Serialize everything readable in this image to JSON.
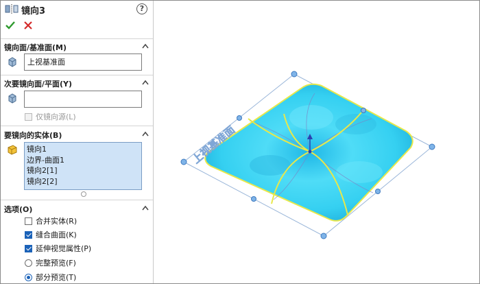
{
  "feature": {
    "title": "镜向3",
    "help": "?"
  },
  "sections": {
    "mirror_face": {
      "title": "镜向面/基准面(M)",
      "value": "上视基准面"
    },
    "secondary_face": {
      "title": "次要镜向面/平面(Y)",
      "value": "",
      "option": "仅镜向源(L)"
    },
    "bodies": {
      "title": "要镜向的实体(B)",
      "items": [
        "镜向1",
        "边界-曲面1",
        "镜向2[1]",
        "镜向2[2]"
      ]
    },
    "options": {
      "title": "选项(O)",
      "merge": "合并实体(R)",
      "merge_checked": false,
      "knit": "缝合曲面(K)",
      "knit_checked": true,
      "propagate": "延伸视觉属性(P)",
      "propagate_checked": true,
      "full_preview": "完整预览(F)",
      "partial_preview": "部分预览(T)",
      "preview_selected": "partial"
    }
  },
  "viewport": {
    "plane_label": "上视基准面",
    "colors": {
      "surface": "#2fd3f3",
      "edge": "#e8e84a",
      "plane": "#9ab6d9",
      "handle": "#7fb4e8"
    }
  }
}
